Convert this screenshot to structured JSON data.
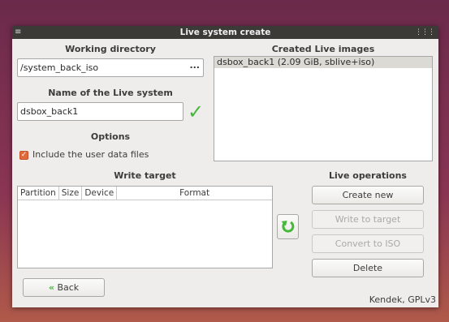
{
  "window": {
    "title": "Live system create"
  },
  "working_directory": {
    "label": "Working directory",
    "value": "/system_back_iso",
    "browse": "..."
  },
  "live_name": {
    "label": "Name of the Live system",
    "value": "dsbox_back1"
  },
  "options": {
    "label": "Options",
    "include_user_data": {
      "label": "Include the user data files",
      "checked": true
    }
  },
  "created_images": {
    "label": "Created Live images",
    "items": [
      "dsbox_back1 (2.09 GiB, sblive+iso)"
    ]
  },
  "write_target": {
    "label": "Write target",
    "columns": [
      "Partition",
      "Size",
      "Device",
      "Format"
    ]
  },
  "live_operations": {
    "label": "Live operations",
    "create_new": "Create new",
    "write_to_target": "Write to target",
    "convert_to_iso": "Convert to ISO",
    "delete": "Delete"
  },
  "back_button": {
    "icon": "«",
    "label": "Back"
  },
  "footer": "Kendek, GPLv3",
  "colors": {
    "accent": "#45b83a",
    "checkbox": "#e16a3c",
    "titlebar": "#3b3a36"
  }
}
